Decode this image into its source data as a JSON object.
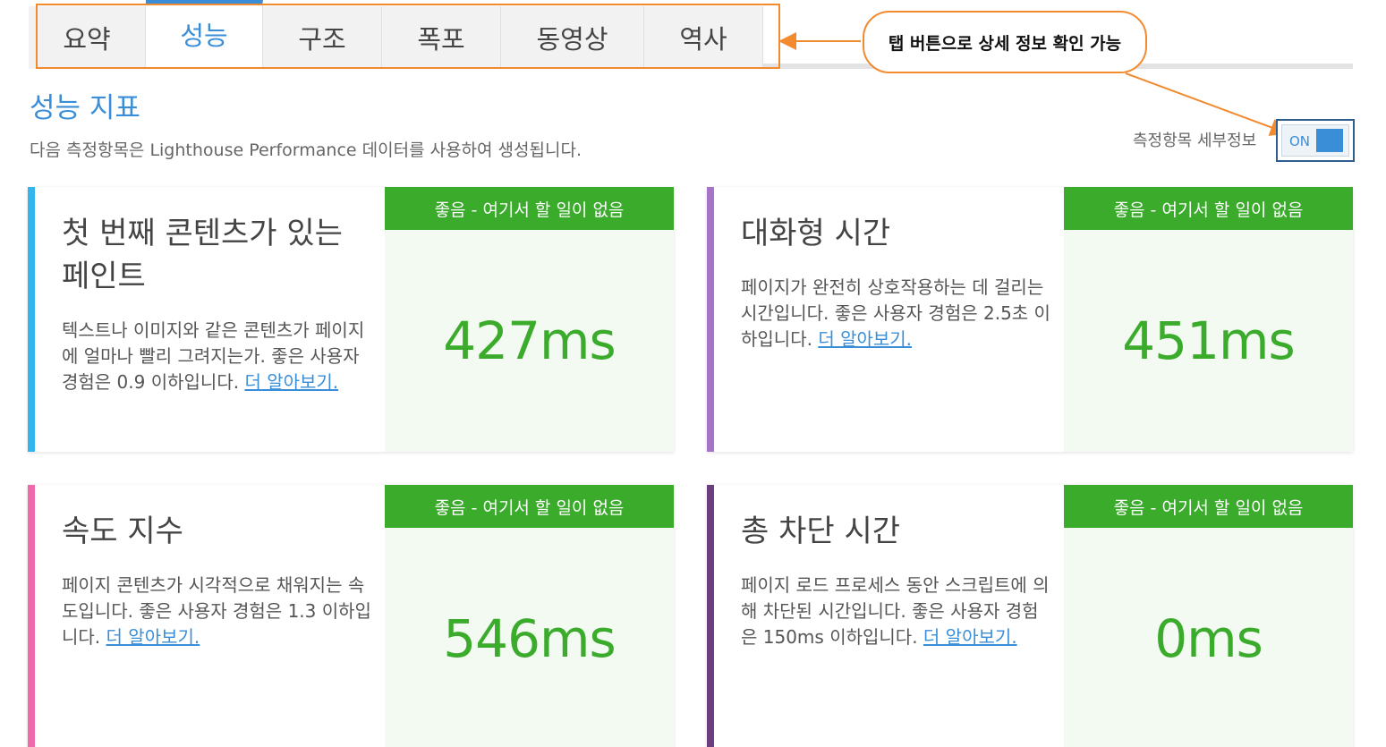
{
  "tabs": [
    {
      "label": "요약",
      "active": false
    },
    {
      "label": "성능",
      "active": true
    },
    {
      "label": "구조",
      "active": false
    },
    {
      "label": "폭포",
      "active": false
    },
    {
      "label": "동영상",
      "active": false
    },
    {
      "label": "역사",
      "active": false
    }
  ],
  "annotation": {
    "callout_text": "탭 버튼으로 상세 정보 확인 가능",
    "color": "#f28a30"
  },
  "section": {
    "title": "성능 지표",
    "description": "다음 측정항목은 Lighthouse Performance 데이터를 사용하여 생성됩니다."
  },
  "toggle": {
    "label": "측정항목 세부정보",
    "state_text": "ON"
  },
  "metrics": [
    {
      "title": "첫 번째 콘텐츠가 있는 페인트",
      "description": "텍스트나 이미지와 같은 콘텐츠가 페이지에 얼마나 빨리 그려지는가. 좋은 사용자 경험은 0.9 이하입니다.",
      "link": "더 알아보기.",
      "status": "좋음 - 여기서 할 일이 없음",
      "value": "427ms",
      "accent_color": "#35b5ee"
    },
    {
      "title": "대화형 시간",
      "description": "페이지가 완전히 상호작용하는 데 걸리는 시간입니다. 좋은 사용자 경험은 2.5초 이하입니다.",
      "link": "더 알아보기.",
      "status": "좋음 - 여기서 할 일이 없음",
      "value": "451ms",
      "accent_color": "#a673c9"
    },
    {
      "title": "속도 지수",
      "description": "페이지 콘텐츠가 시각적으로 채워지는 속도입니다. 좋은 사용자 경험은 1.3 이하입니다.",
      "link": "더 알아보기.",
      "status": "좋음 - 여기서 할 일이 없음",
      "value": "546ms",
      "accent_color": "#ee6aaa"
    },
    {
      "title": "총 차단 시간",
      "description": "페이지 로드 프로세스 동안 스크립트에 의해 차단된 시간입니다. 좋은 사용자 경험은 150ms 이하입니다.",
      "link": "더 알아보기.",
      "status": "좋음 - 여기서 할 일이 없음",
      "value": "0ms",
      "accent_color": "#6b3f7e"
    }
  ],
  "colors": {
    "brand_blue": "#3a8ed8",
    "good_green": "#3bab2c",
    "good_panel": "#f2faf1"
  }
}
